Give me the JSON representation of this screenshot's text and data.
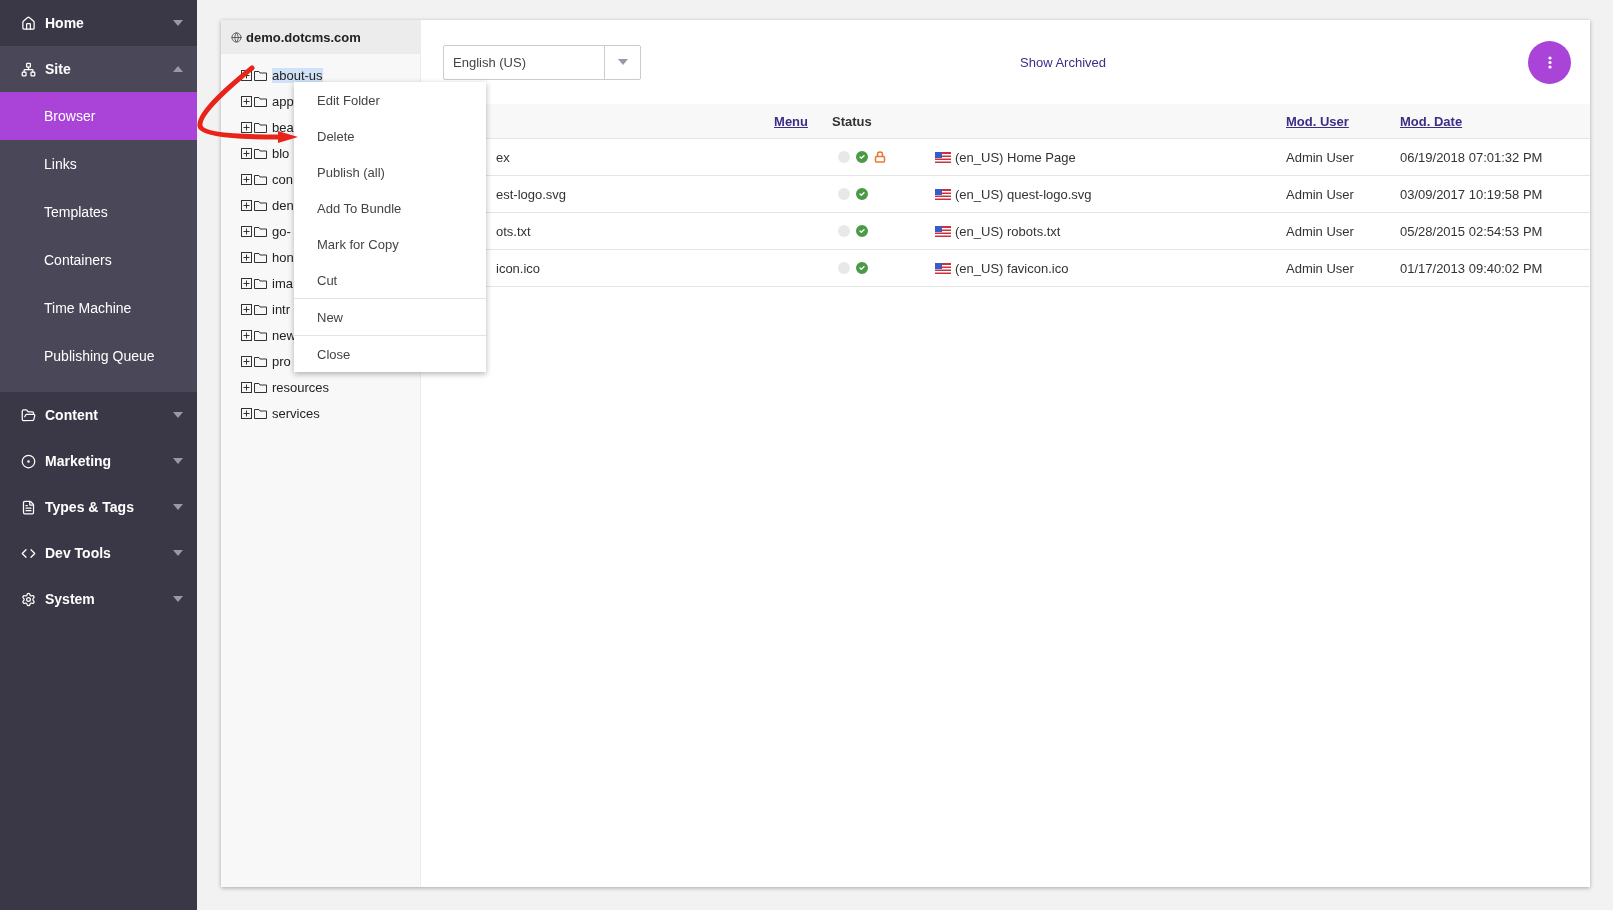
{
  "sidebar": {
    "sections": [
      {
        "label": "Home",
        "expanded": false
      },
      {
        "label": "Site",
        "expanded": true,
        "children": [
          {
            "label": "Browser",
            "selected": true
          },
          {
            "label": "Links",
            "selected": false
          },
          {
            "label": "Templates",
            "selected": false
          },
          {
            "label": "Containers",
            "selected": false
          },
          {
            "label": "Time Machine",
            "selected": false
          },
          {
            "label": "Publishing Queue",
            "selected": false
          }
        ]
      },
      {
        "label": "Content",
        "expanded": false
      },
      {
        "label": "Marketing",
        "expanded": false
      },
      {
        "label": "Types & Tags",
        "expanded": false
      },
      {
        "label": "Dev Tools",
        "expanded": false
      },
      {
        "label": "System",
        "expanded": false
      }
    ]
  },
  "tree": {
    "site": "demo.dotcms.com",
    "folders": [
      {
        "label": "about-us",
        "selected": true
      },
      {
        "label": "app",
        "selected": false
      },
      {
        "label": "bea",
        "selected": false
      },
      {
        "label": "blo",
        "selected": false
      },
      {
        "label": "con",
        "selected": false
      },
      {
        "label": "den",
        "selected": false
      },
      {
        "label": "go-",
        "selected": false
      },
      {
        "label": "hon",
        "selected": false
      },
      {
        "label": "ima",
        "selected": false
      },
      {
        "label": "intr",
        "selected": false
      },
      {
        "label": "new",
        "selected": false
      },
      {
        "label": "pro",
        "selected": false
      },
      {
        "label": "resources",
        "selected": false
      },
      {
        "label": "services",
        "selected": false
      }
    ]
  },
  "toolbar": {
    "language": "English (US)",
    "show_archived": "Show Archived"
  },
  "table": {
    "columns": [
      {
        "label": "Menu",
        "sortable": true
      },
      {
        "label": "Status",
        "sortable": false
      },
      {
        "label": "Mod. User",
        "sortable": true
      },
      {
        "label": "Mod. Date",
        "sortable": true
      }
    ],
    "rows": [
      {
        "name": "ex",
        "locked": true,
        "description": "(en_US) Home Page",
        "mod_user": "Admin User",
        "mod_date": "06/19/2018 07:01:32 PM"
      },
      {
        "name": "est-logo.svg",
        "locked": false,
        "description": "(en_US) quest-logo.svg",
        "mod_user": "Admin User",
        "mod_date": "03/09/2017 10:19:58 PM"
      },
      {
        "name": "ots.txt",
        "locked": false,
        "description": "(en_US) robots.txt",
        "mod_user": "Admin User",
        "mod_date": "05/28/2015 02:54:53 PM"
      },
      {
        "name": "icon.ico",
        "locked": false,
        "description": "(en_US) favicon.ico",
        "mod_user": "Admin User",
        "mod_date": "01/17/2013 09:40:02 PM"
      }
    ]
  },
  "context_menu": {
    "groups": [
      [
        "Edit Folder",
        "Delete",
        "Publish (all)",
        "Add To Bundle",
        "Mark for Copy",
        "Cut"
      ],
      [
        "New"
      ],
      [
        "Close"
      ]
    ]
  }
}
